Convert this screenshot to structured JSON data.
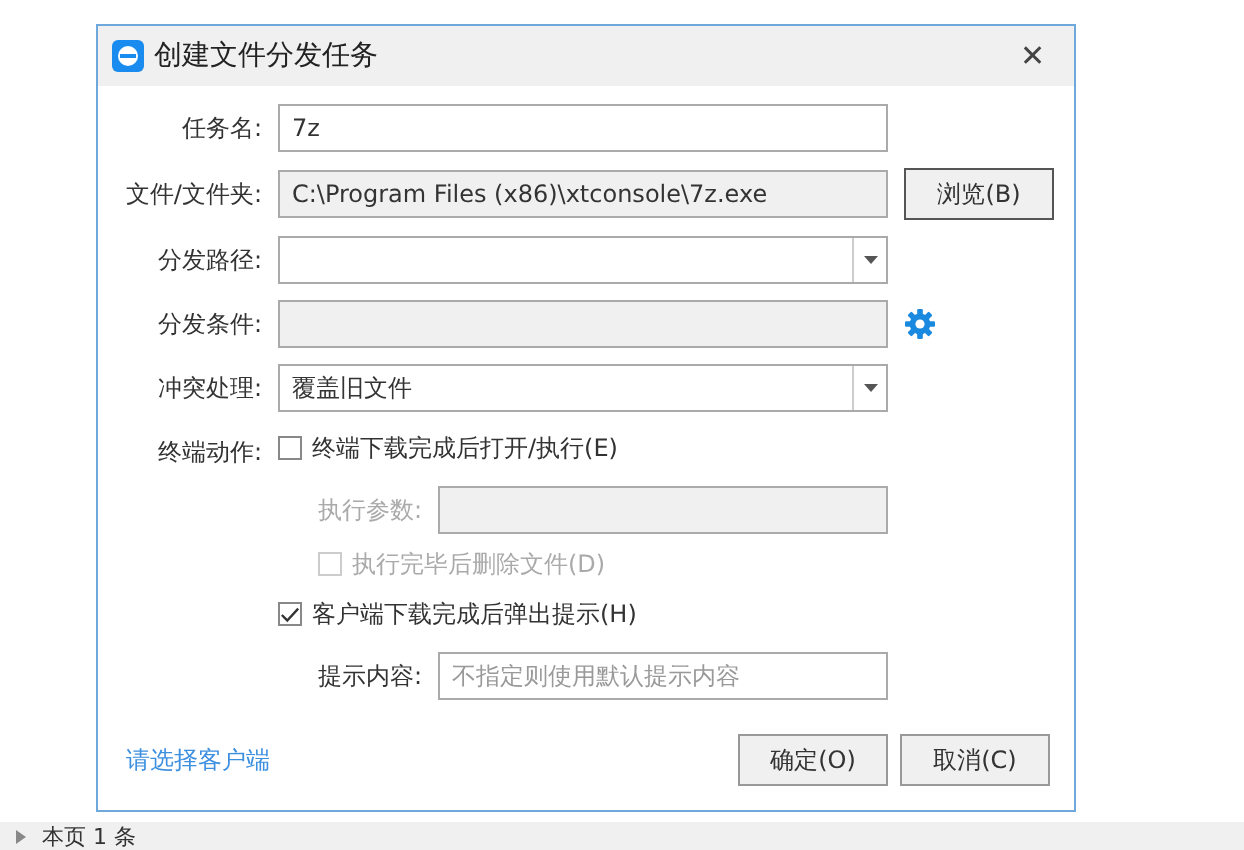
{
  "dialog": {
    "title": "创建文件分发任务",
    "close": "✕"
  },
  "fields": [
    {
      "kind": "text",
      "label": "任务名:",
      "value": "7z"
    },
    {
      "kind": "path",
      "label": "文件/文件夹:",
      "value": "C:\\Program Files (x86)\\xtconsole\\7z.exe",
      "button": "浏览(B)"
    },
    {
      "kind": "select",
      "label": "分发路径:"
    },
    {
      "kind": "condition",
      "label": "分发条件:"
    },
    {
      "kind": "select",
      "label": "冲突处理:",
      "value": "覆盖旧文件"
    }
  ],
  "terminal_action": {
    "label": "终端动作:",
    "options": [
      {
        "kind": "checkbox",
        "label": "终端下载完成后打开/执行(E)",
        "checked": false,
        "disabled": false
      },
      {
        "kind": "field",
        "label": "执行参数:",
        "disabled": true
      },
      {
        "kind": "checkbox",
        "label": "执行完毕后删除文件(D)",
        "checked": false,
        "disabled": true
      },
      {
        "kind": "checkbox",
        "label": "客户端下载完成后弹出提示(H)",
        "checked": true,
        "disabled": false
      },
      {
        "kind": "field",
        "label": "提示内容:",
        "disabled": false,
        "placeholder": "不指定则使用默认提示内容"
      }
    ]
  },
  "footer": {
    "link": "请选择客户端",
    "buttons": [
      "确定(O)",
      "取消(C)"
    ]
  },
  "status_bar": {
    "text": "本页 1 条"
  }
}
